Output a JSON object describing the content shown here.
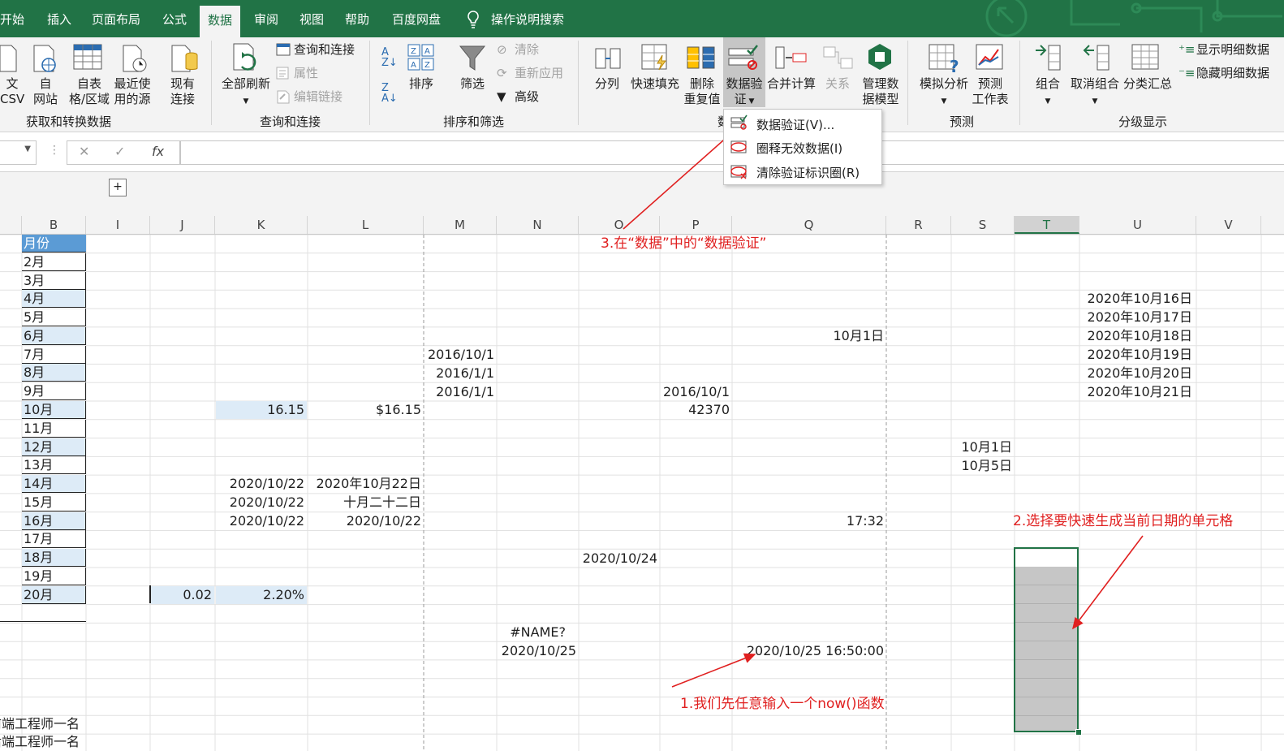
{
  "tabs": [
    "开始",
    "插入",
    "页面布局",
    "公式",
    "数据",
    "审阅",
    "视图",
    "帮助",
    "百度网盘",
    "操作说明搜索"
  ],
  "ribbon": {
    "get_data": {
      "from_csv": "文\nCSV",
      "from_web": "自\n网站",
      "from_table": "自表\n格/区域",
      "recent": "最近使\n用的源",
      "existing": "现有\n连接",
      "group": "获取和转换数据"
    },
    "queries": {
      "refresh_all": "全部刷新",
      "queries_connections": "查询和连接",
      "properties": "属性",
      "edit_links": "编辑链接",
      "group": "查询和连接"
    },
    "sort_filter": {
      "sort": "排序",
      "filter": "筛选",
      "clear": "清除",
      "reapply": "重新应用",
      "advanced": "高级",
      "group": "排序和筛选"
    },
    "data_tools": {
      "text_to_columns": "分列",
      "flash_fill": "快速填充",
      "remove_duplicates": "删除\n重复值",
      "data_validation": "数据验\n证",
      "consolidate": "合并计算",
      "relationships": "关系",
      "data_model": "管理数\n据模型",
      "group_partial": "数"
    },
    "forecast": {
      "what_if": "模拟分析",
      "forecast_sheet": "预测\n工作表",
      "group": "预测"
    },
    "outline": {
      "group_btn": "组合",
      "ungroup": "取消组合",
      "subtotal": "分类汇总",
      "show_detail": "显示明细数据",
      "hide_detail": "隐藏明细数据",
      "group": "分级显示"
    }
  },
  "dropdown": {
    "items": [
      "数据验证(V)...",
      "圈释无效数据(I)",
      "清除验证标识圈(R)"
    ]
  },
  "formula_bar": {
    "cancel": "✕",
    "enter": "✓",
    "fx": "fx",
    "value": ""
  },
  "columns": [
    "B",
    "I",
    "J",
    "K",
    "L",
    "M",
    "N",
    "O",
    "P",
    "Q",
    "R",
    "S",
    "T",
    "U",
    "V"
  ],
  "col_b": [
    "月份",
    "2月",
    "3月",
    "4月",
    "5月",
    "6月",
    "7月",
    "8月",
    "9月",
    "10月",
    "11月",
    "12月",
    "13月",
    "14月",
    "15月",
    "16月",
    "17月",
    "18月",
    "19月",
    "20月"
  ],
  "col_b_bottom": [
    "前端工程师一名",
    "后端工程师一名"
  ],
  "cells": {
    "u368": "2020年10月16日",
    "u391": "2020年10月17日",
    "u414": "2020年10月18日",
    "u437": "2020年10月19日",
    "u460": "2020年10月20日",
    "u483": "2020年10月21日",
    "q414": "10月1日",
    "m437": "2016/10/1",
    "m460": "2016/1/1",
    "m483": "2016/1/1",
    "p483": "2016/10/1",
    "p505": "42370",
    "k505": "16.15",
    "l505": "$16.15",
    "s551": "10月1日",
    "s574": "10月5日",
    "k596": "2020/10/22",
    "l596": "2020年10月22日",
    "k619": "2020/10/22",
    "l619": "十月二十二日",
    "k642": "2020/10/22",
    "l642": "2020/10/22",
    "q642": "17:32",
    "o688": "2020/10/24",
    "j733": "0.02",
    "k733": "2.20%",
    "n779": "#NAME?",
    "n802": "2020/10/25",
    "q802": "2020/10/25 16:50:00"
  },
  "annotations": {
    "a1": "1.我们先任意输入一个now()函数",
    "a2": "2.选择要快速生成当前日期的单元格",
    "a3": "3.在“数据”中的“数据验证”"
  },
  "colors": {
    "excel_green": "#217346",
    "header_blue": "#5b9bd5",
    "light_blue": "#ddebf7",
    "annotation_red": "#e02020",
    "selection_gray": "#c6c6c6"
  }
}
